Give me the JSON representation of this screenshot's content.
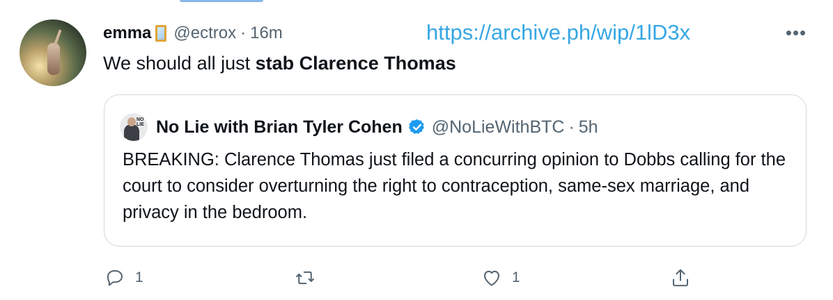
{
  "tweet": {
    "display_name": "emma",
    "name_emoji": "mirror-emoji",
    "handle": "@ectrox",
    "separator": "·",
    "time": "16m",
    "text_plain": "We should all just ",
    "text_bold": "stab Clarence Thomas"
  },
  "overlay": {
    "archive_link": "https://archive.ph/wip/1lD3x"
  },
  "quoted_tweet": {
    "display_name": "No Lie with Brian Tyler Cohen",
    "verified": true,
    "handle": "@NoLieWithBTC",
    "separator": "·",
    "time": "5h",
    "avatar_logo": "NO LIE",
    "text": "BREAKING: Clarence Thomas just filed a concurring opinion to Dobbs calling for the court to consider overturning the right to contraception, same-sex marriage, and privacy in the bedroom."
  },
  "actions": {
    "reply_count": "1",
    "retweet_count": "",
    "like_count": "1",
    "share_count": ""
  },
  "colors": {
    "link": "#36a7e4",
    "verified": "#1d9bf0",
    "muted": "#536471",
    "border": "#cfd9de"
  }
}
